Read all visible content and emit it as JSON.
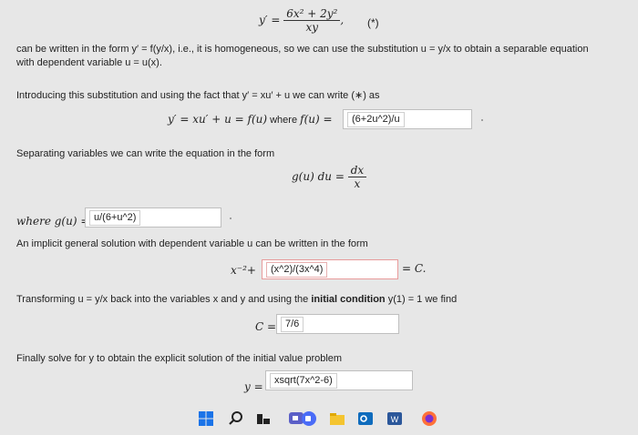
{
  "eq": {
    "lhs": "y′ =",
    "num": "6x² + 2y²",
    "den": "xy",
    "comma": ",",
    "tag": "(*)"
  },
  "intro": {
    "line1": "can be written in the form y′ = f(y/x), i.e., it is homogeneous, so we can use the substitution u = y/x to obtain a separable equation",
    "line2": "with dependent variable u = u(x)."
  },
  "step1": {
    "text": "Introducing this substitution and using the fact that y′ = xu′ + u we can write (∗) as",
    "lhs": "y′ = xu′ + u = f(u)",
    "where": " where ",
    "fu": "f(u) =",
    "answer": "(6+2u^2)/u"
  },
  "step2": {
    "text": "Separating variables we can write the equation in the form",
    "lhs": "g(u) du =",
    "num": "dx",
    "den": "x",
    "where_label": "where g(u) =",
    "answer": "u/(6+u^2)"
  },
  "step3": {
    "text": "An implicit general solution with dependent variable u can be written in the form",
    "prefix": "x⁻²+",
    "answer": "(x^2)/(3x^4)",
    "suffix": "= C."
  },
  "step4": {
    "text_a": "Transforming u = y/x back into the variables x and y and using the ",
    "bold": "initial condition",
    "text_b": " y(1) = 1 we find",
    "lhs": "C =",
    "answer": "7/6"
  },
  "step5": {
    "text": "Finally solve for y to obtain the explicit solution of the initial value problem",
    "lhs": "y =",
    "answer": "xsqrt(7x^2-6)"
  },
  "taskbar": {
    "icons": [
      "windows-icon",
      "search-icon",
      "task-view-icon",
      "meet-icon",
      "file-explorer-icon",
      "outlook-icon",
      "word-icon",
      "firefox-icon"
    ],
    "colors": {
      "windows": "#1a73e8",
      "outlook": "#0f6cbd",
      "word": "#2b579a",
      "firefox": "#ff7139"
    }
  }
}
